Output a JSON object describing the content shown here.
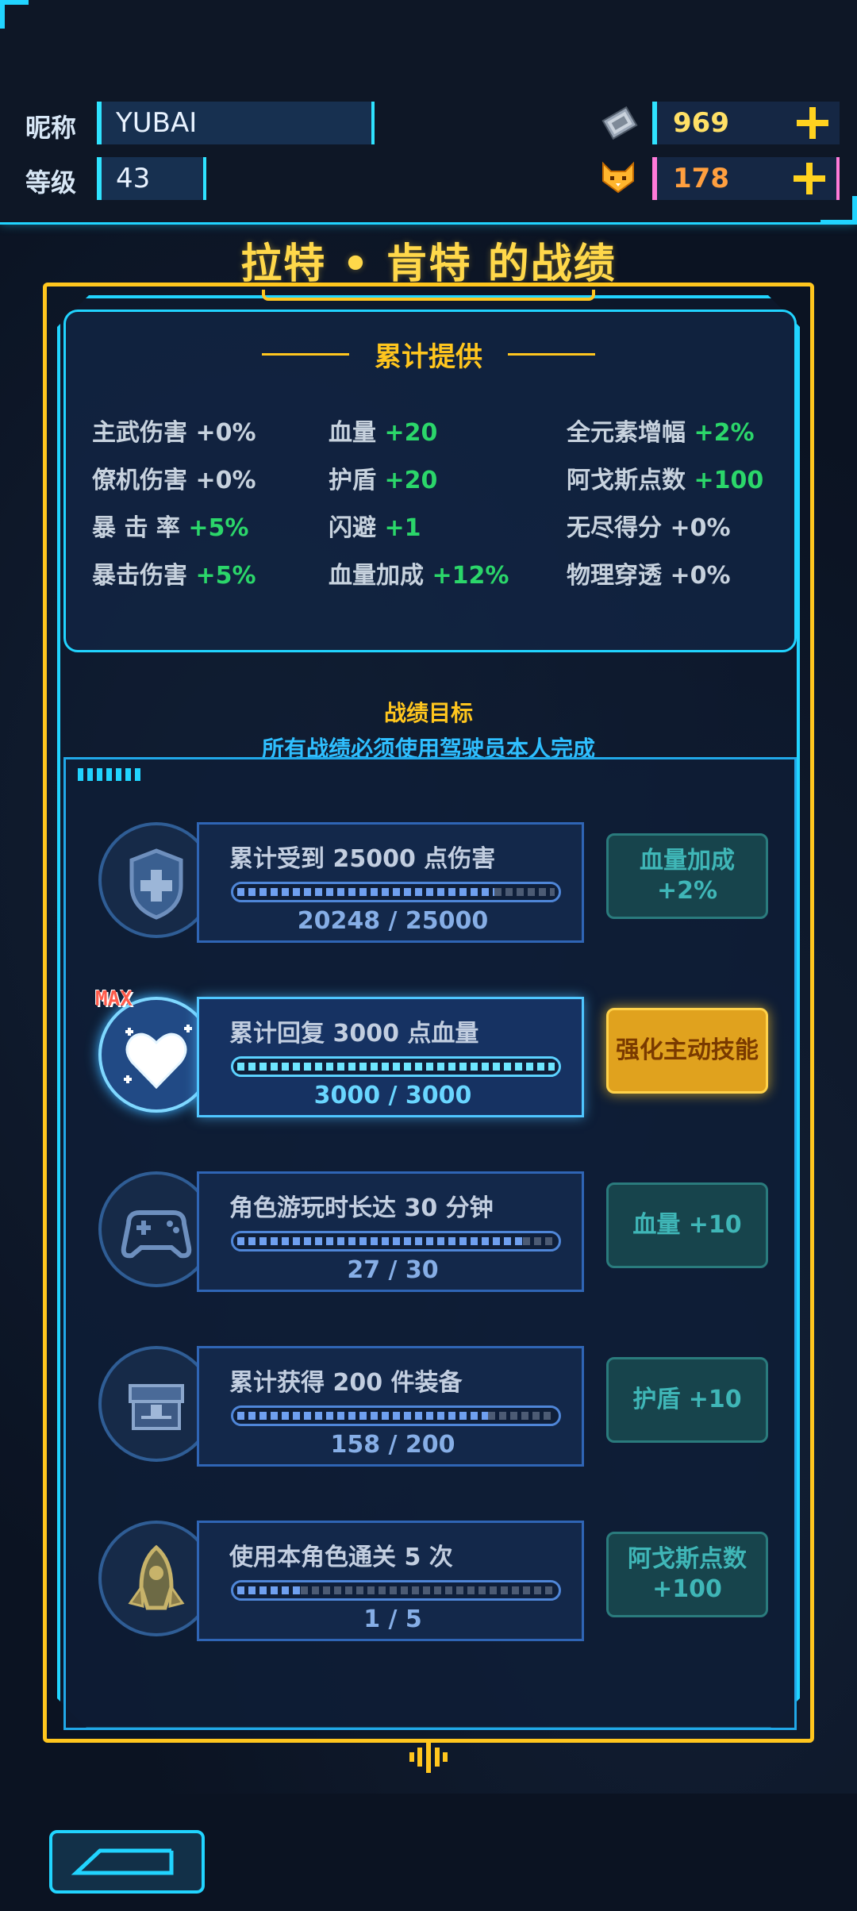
{
  "header": {
    "nickname_label": "昵称",
    "nickname": "YUBAI",
    "level_label": "等级",
    "level": "43",
    "currency1_icon": "crystal-chip-icon",
    "currency1": "969",
    "currency2_icon": "fox-badge-icon",
    "currency2": "178"
  },
  "title": "拉特 • 肯特 的战绩",
  "stats": {
    "title": "累计提供",
    "items": [
      {
        "label": "主武伤害",
        "value": "+0%"
      },
      {
        "label": "血量",
        "value": "+20"
      },
      {
        "label": "全元素增幅",
        "value": "+2%"
      },
      {
        "label": "僚机伤害",
        "value": "+0%"
      },
      {
        "label": "护盾",
        "value": "+20"
      },
      {
        "label": "阿戈斯点数",
        "value": "+100"
      },
      {
        "label": "暴 击 率",
        "value": "+5%"
      },
      {
        "label": "闪避",
        "value": "+1"
      },
      {
        "label": "无尽得分",
        "value": "+0%"
      },
      {
        "label": "暴击伤害",
        "value": "+5%"
      },
      {
        "label": "血量加成",
        "value": "+12%"
      },
      {
        "label": "物理穿透",
        "value": "+0%"
      }
    ]
  },
  "goals_title": "战绩目标",
  "goals_sub": "所有战绩必须使用驾驶员本人完成",
  "goals": [
    {
      "icon": "shield-icon",
      "title": "累计受到 25000 点伤害",
      "current": 20248,
      "target": 25000,
      "progress": "20248 / 25000",
      "reward": "血量加成\n+2%",
      "active": false,
      "max": ""
    },
    {
      "icon": "heart-icon",
      "title": "累计回复 3000 点血量",
      "current": 3000,
      "target": 3000,
      "progress": "3000 / 3000",
      "reward": "强化主动技能",
      "active": true,
      "max": "MAX"
    },
    {
      "icon": "gamepad-icon",
      "title": "角色游玩时长达 30 分钟",
      "current": 27,
      "target": 30,
      "progress": "27 / 30",
      "reward": "血量 +10",
      "active": false,
      "max": ""
    },
    {
      "icon": "chest-icon",
      "title": "累计获得 200 件装备",
      "current": 158,
      "target": 200,
      "progress": "158 / 200",
      "reward": "护盾 +10",
      "active": false,
      "max": ""
    },
    {
      "icon": "rocket-icon",
      "title": "使用本角色通关 5 次",
      "current": 1,
      "target": 5,
      "progress": "1 / 5",
      "reward": "阿戈斯点数\n+100",
      "active": false,
      "max": ""
    }
  ]
}
